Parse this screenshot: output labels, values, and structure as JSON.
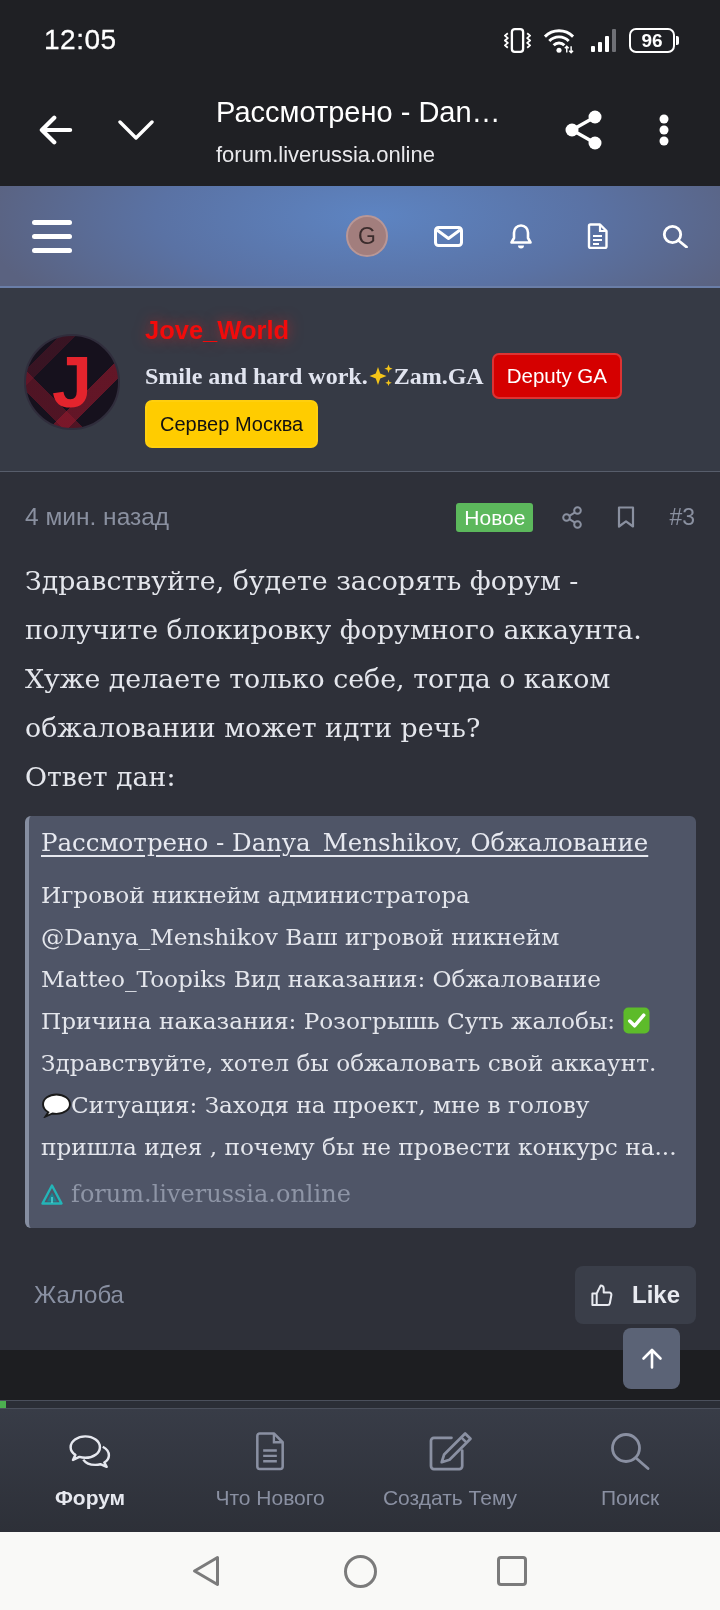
{
  "status_bar": {
    "time": "12:05",
    "battery": "96"
  },
  "browser_toolbar": {
    "title": "Рассмотрено - Dan…",
    "url": "forum.liverussia.online"
  },
  "forum_header": {
    "avatar_letter": "G"
  },
  "post": {
    "author": {
      "name": "Jove_World",
      "avatar_letter": "J",
      "title": [
        {
          "kind": "text",
          "text": "Smile and hard work."
        },
        {
          "kind": "sparkles"
        },
        {
          "kind": "text",
          "text": "Zam.GA"
        }
      ],
      "badges": [
        {
          "text": "Deputy GA",
          "color": "#d50000"
        },
        {
          "text": "Сервер Москва",
          "color": "#ffcc00"
        }
      ]
    },
    "time": "4 мин. назад",
    "new_label": "Новое",
    "number": "#3",
    "body": [
      "Здравствуйте, будете засорять форум - получите блокировку форумного аккаунта. Хуже делаете только себе, тогда о каком обжаловании может идти речь?",
      "Ответ дан:"
    ],
    "quote": {
      "title": "Рассмотрено - Danya_Menshikov, Обжалование",
      "excerpt": [
        {
          "kind": "text",
          "text": "Игровой никнейм администратора @Danya_Menshikov Ваш игровой никнейм Matteo_Toopiks Вид наказания: Обжалование Причина наказания: Розогрышь Суть жалобы: "
        },
        {
          "kind": "check"
        },
        {
          "kind": "text",
          "text": " Здравствуйте, хотел бы обжаловать свой аккаунт. "
        },
        {
          "kind": "speech"
        },
        {
          "kind": "text",
          "text": "Ситуация: Заходя на проект, мне в голову пришла идея , почему бы не провести конкурс на..."
        }
      ],
      "site": "forum.liverussia.online"
    },
    "report_link": "Жалоба",
    "like_label": "Like"
  },
  "reading_progress": {
    "level": 0.008
  },
  "bottom_nav": [
    {
      "label": "Форум",
      "selected": true
    },
    {
      "label": "Что Нового",
      "selected": false
    },
    {
      "label": "Создать Тему",
      "selected": false
    },
    {
      "label": "Поиск",
      "selected": false
    }
  ]
}
